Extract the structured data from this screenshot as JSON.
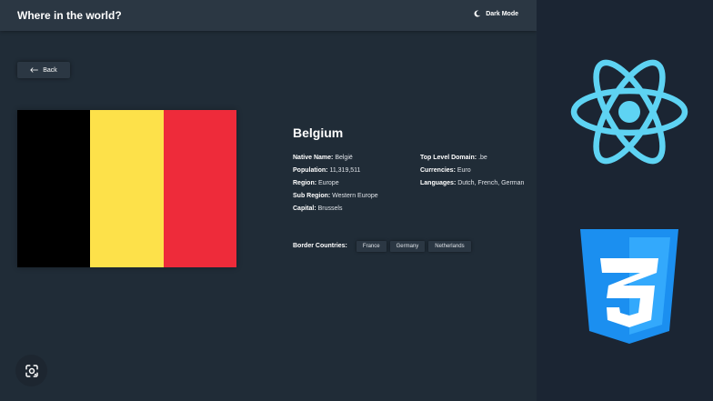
{
  "app": {
    "title": "Where in the world?",
    "dark_mode_label": "Dark Mode"
  },
  "nav": {
    "back_label": "Back"
  },
  "country": {
    "name": "Belgium",
    "flag_colors": [
      "#000000",
      "#FDE14A",
      "#EE2B3A"
    ],
    "details_left": [
      {
        "label": "Native Name:",
        "value": "België"
      },
      {
        "label": "Population:",
        "value": "11,319,511"
      },
      {
        "label": "Region:",
        "value": "Europe"
      },
      {
        "label": "Sub Region:",
        "value": "Western Europe"
      },
      {
        "label": "Capital:",
        "value": "Brussels"
      }
    ],
    "details_right": [
      {
        "label": "Top Level Domain:",
        "value": ".be"
      },
      {
        "label": "Currencies:",
        "value": "Euro"
      },
      {
        "label": "Languages:",
        "value": "Dutch, French, German"
      }
    ],
    "border_label": "Border Countries:",
    "borders": [
      "France",
      "Germany",
      "Netherlands"
    ]
  },
  "overlay": {
    "react_logo_icon": "react-atom-icon",
    "css3_logo_icon": "css3-shield-icon",
    "lens_icon": "lens-camera-icon",
    "react_color": "#5ED3F3",
    "css_color": "#1B8FF0"
  }
}
